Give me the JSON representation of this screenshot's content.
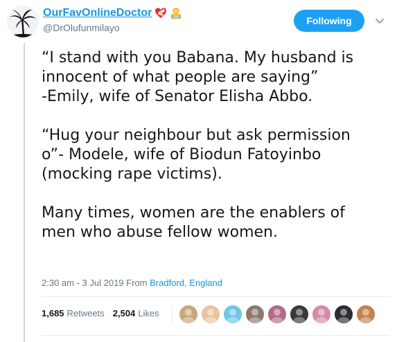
{
  "author": {
    "display_name": "OurFavOnlineDoctor",
    "handle": "@DrOlufunmilayo",
    "name_emojis": [
      "heart-with-bandage-emoji",
      "woman-technologist-emoji"
    ]
  },
  "follow_button": {
    "label": "Following"
  },
  "tweet": {
    "paragraphs": [
      "“I stand with you Babana. My husband is\ninnocent of what people are saying”\n-Emily, wife of Senator Elisha Abbo.",
      "“Hug your neighbour but ask permission\no”- Modele, wife of Biodun Fatoyinbo\n(mocking rape victims).",
      "Many times, women are the enablers of\nmen who abuse fellow women."
    ]
  },
  "meta": {
    "time": "2:30 am",
    "separator": " - ",
    "date": "3 Jul 2019",
    "from_label": " From ",
    "location": "Bradford, England"
  },
  "stats": {
    "retweets_count": "1,685",
    "retweets_label": "Retweets",
    "likes_count": "2,504",
    "likes_label": "Likes"
  },
  "likers": [
    {
      "name": "liker-avatar-1",
      "color": "#c9a77e"
    },
    {
      "name": "liker-avatar-2",
      "color": "#e8c4a0"
    },
    {
      "name": "liker-avatar-3",
      "color": "#6ec6e8"
    },
    {
      "name": "liker-avatar-4",
      "color": "#8a7a6e"
    },
    {
      "name": "liker-avatar-5",
      "color": "#b06a8a"
    },
    {
      "name": "liker-avatar-6",
      "color": "#3a3a3a"
    },
    {
      "name": "liker-avatar-7",
      "color": "#d48aa8"
    },
    {
      "name": "liker-avatar-8",
      "color": "#2c2c34"
    },
    {
      "name": "liker-avatar-9",
      "color": "#c2834e"
    }
  ],
  "colors": {
    "accent": "#1da1f2",
    "link": "#1b95e0",
    "secondary_text": "#657786",
    "primary_text": "#14171a"
  }
}
